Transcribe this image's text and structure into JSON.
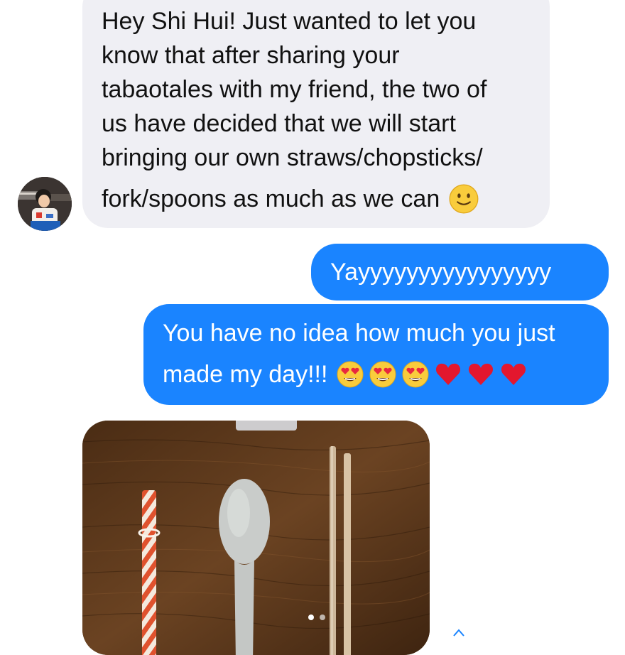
{
  "conversation": {
    "incoming": {
      "lines": [
        "Hey Shi Hui! Just wanted to let you",
        "know that after sharing your",
        "tabaotales with my friend, the two of",
        "us have decided that we will start",
        "bringing our own straws/chopsticks/",
        "fork/spoons as much as we can"
      ],
      "emoji": "slightly-smiling-face"
    },
    "outgoing": [
      {
        "text": "Yayyyyyyyyyyyyyyyy"
      },
      {
        "lines": [
          "You have no idea how much you just",
          "made my day!!!"
        ],
        "emojis": [
          "heart-eyes",
          "heart-eyes",
          "heart-eyes",
          "red-heart",
          "red-heart",
          "red-heart"
        ]
      }
    ],
    "photo": {
      "subject": "straw, spoon and chopsticks on wooden table",
      "page_indicator": {
        "current": 1,
        "total": 2
      }
    }
  },
  "colors": {
    "incoming_bubble": "#efeff4",
    "outgoing_bubble": "#1a84ff",
    "incoming_text": "#111111",
    "outgoing_text": "#ffffff"
  }
}
